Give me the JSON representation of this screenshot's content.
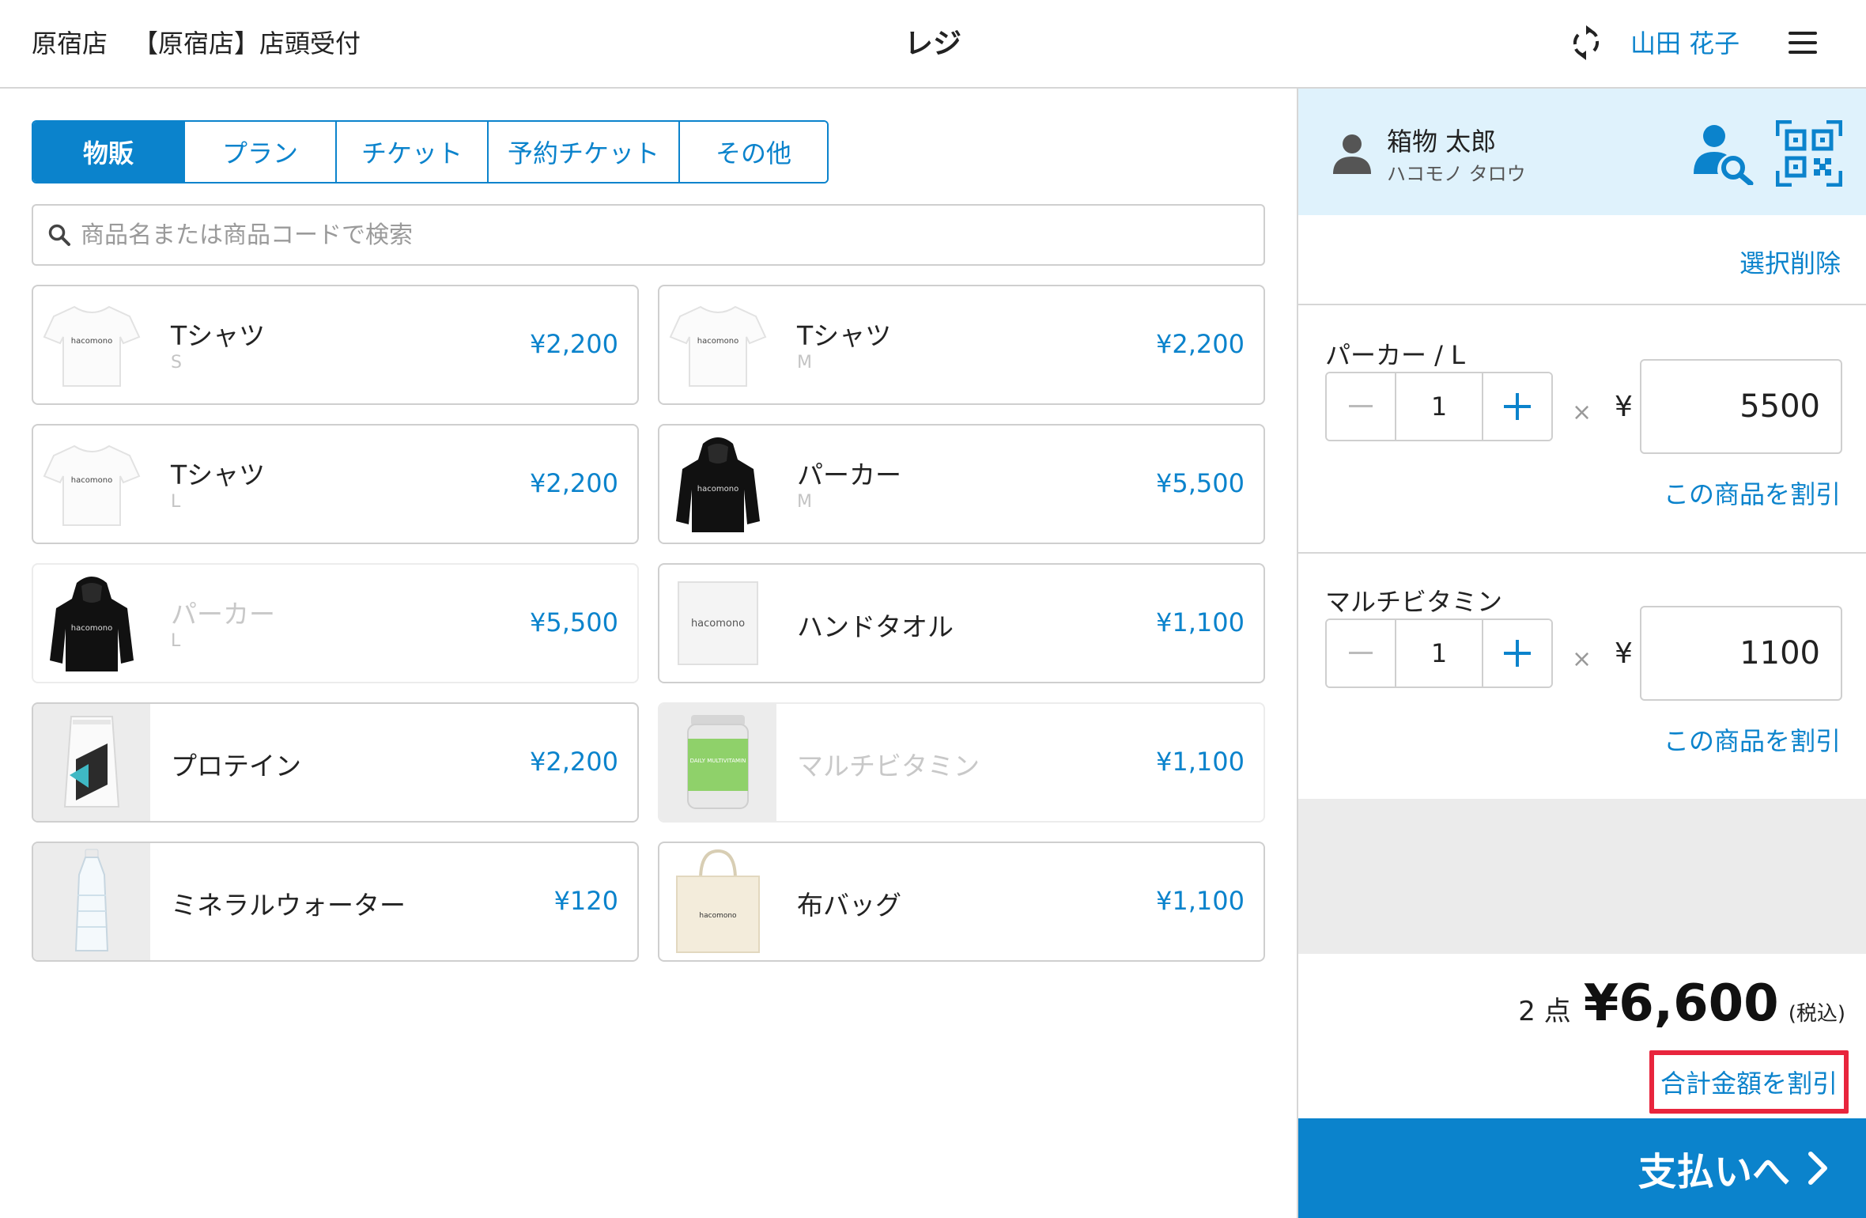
{
  "header": {
    "store": "原宿店",
    "reception": "【原宿店】店頭受付",
    "title": "レジ",
    "staff": "山田 花子"
  },
  "tabs": [
    "物販",
    "プラン",
    "チケット",
    "予約チケット",
    "その他"
  ],
  "search": {
    "placeholder": "商品名または商品コードで検索"
  },
  "products": [
    {
      "name": "Tシャツ",
      "variant": "S",
      "price": "¥2,200"
    },
    {
      "name": "Tシャツ",
      "variant": "M",
      "price": "¥2,200"
    },
    {
      "name": "Tシャツ",
      "variant": "L",
      "price": "¥2,200"
    },
    {
      "name": "パーカー",
      "variant": "M",
      "price": "¥5,500"
    },
    {
      "name": "パーカー",
      "variant": "L",
      "price": "¥5,500"
    },
    {
      "name": "ハンドタオル",
      "variant": "",
      "price": "¥1,100"
    },
    {
      "name": "プロテイン",
      "variant": "",
      "price": "¥2,200"
    },
    {
      "name": "マルチビタミン",
      "variant": "",
      "price": "¥1,100"
    },
    {
      "name": "ミネラルウォーター",
      "variant": "",
      "price": "¥120"
    },
    {
      "name": "布バッグ",
      "variant": "",
      "price": "¥1,100"
    }
  ],
  "brand": "hacomono",
  "vitamin_label": "DAILY MULTIVITAMIN",
  "customer": {
    "name": "箱物 太郎",
    "kana": "ハコモノ タロウ"
  },
  "cart": {
    "clear_label": "選択削除",
    "items": [
      {
        "name": "パーカー / L",
        "qty": "1",
        "times": "×",
        "yen": "¥",
        "price": "5500",
        "discount_label": "この商品を割引"
      },
      {
        "name": "マルチビタミン",
        "qty": "1",
        "times": "×",
        "yen": "¥",
        "price": "1100",
        "discount_label": "この商品を割引"
      }
    ],
    "count": "2 点",
    "total": "¥6,600",
    "tax_label": "(税込)",
    "total_discount_label": "合計金額を割引",
    "pay_label": "支払いへ"
  },
  "colors": {
    "accent": "#0b83cc",
    "highlight": "#e8253d",
    "customer_bg": "#dff2fc"
  }
}
